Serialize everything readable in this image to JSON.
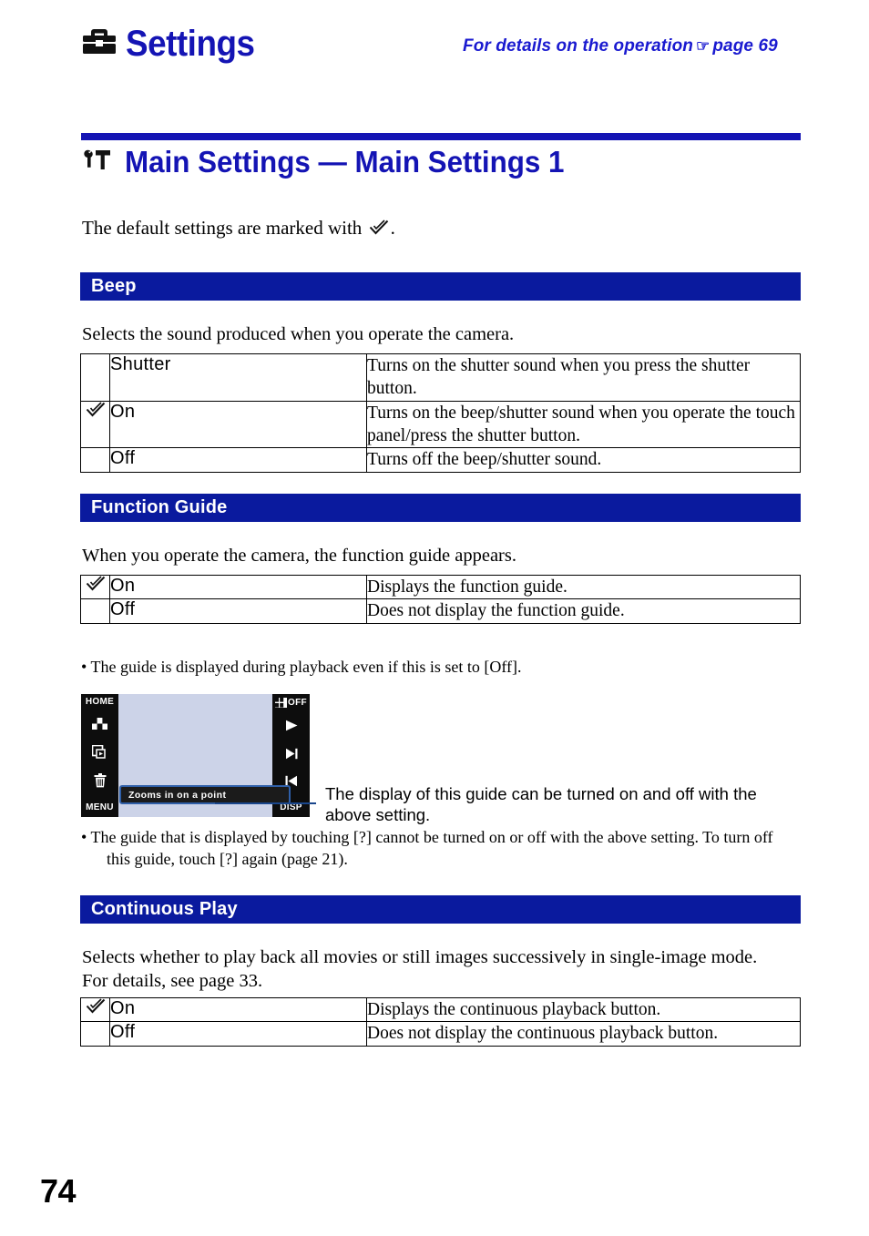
{
  "running_head": {
    "icon": "toolbox-icon",
    "title": "Settings",
    "reference": "For details on the operation",
    "hand_glyph": "☞",
    "page_ref": "page 69"
  },
  "chapter": {
    "icon": "wrench-hammer-icon",
    "title": "Main Settings — Main Settings 1",
    "rule_color": "#1414b4",
    "title_color": "#1414b4"
  },
  "intro": {
    "before_mark": "The default settings are marked with",
    "after_mark": "."
  },
  "sections": [
    {
      "id": "beep",
      "bar_label": "Beep",
      "description": "Selects the sound produced when you operate the camera.",
      "rows": [
        {
          "default": false,
          "label": "Shutter",
          "description": "Turns on the shutter sound when you press the shutter button."
        },
        {
          "default": true,
          "label": "On",
          "description": "Turns on the beep/shutter sound when you operate the touch panel/press the shutter button."
        },
        {
          "default": false,
          "label": "Off",
          "description": "Turns off the beep/shutter sound."
        }
      ]
    },
    {
      "id": "function-guide",
      "bar_label": "Function Guide",
      "description": "When you operate the camera, the function guide appears.",
      "rows": [
        {
          "default": true,
          "label": "On",
          "description": "Displays the function guide."
        },
        {
          "default": false,
          "label": "Off",
          "description": "Does not display the function guide."
        }
      ],
      "note": "• The guide is displayed during playback even if this is set to [Off].",
      "note_after_line1": "• The guide that is displayed by touching [?] cannot be turned on or off with the above setting. To turn off",
      "note_after_line2": "this guide, touch [?] again (page 21)."
    },
    {
      "id": "continuous-play",
      "bar_label": "Continuous Play",
      "description": "Selects whether to play back all movies or still images successively in single-image mode.\nFor details, see page 33.",
      "rows": [
        {
          "default": true,
          "label": "On",
          "description": "Displays the continuous playback button."
        },
        {
          "default": false,
          "label": "Off",
          "description": "Does not display the continuous playback button."
        }
      ]
    }
  ],
  "illustration": {
    "left_buttons": [
      {
        "name": "home-button",
        "text": "HOME"
      },
      {
        "name": "index-view-icon",
        "text": ""
      },
      {
        "name": "slideshow-icon",
        "text": ""
      },
      {
        "name": "delete-trash-icon",
        "text": ""
      },
      {
        "name": "menu-button",
        "text": "MENU"
      }
    ],
    "right_buttons": [
      {
        "name": "grid-off-icon",
        "text": "OFF"
      },
      {
        "name": "play-icon",
        "text": ""
      },
      {
        "name": "next-track-icon",
        "text": ""
      },
      {
        "name": "previous-track-icon",
        "text": ""
      },
      {
        "name": "disp-button",
        "text": "DISP"
      }
    ],
    "tooltip": "Zooms in on a point",
    "screen_bg": "#ccd3e8",
    "bezel_color": "#0d0d0d",
    "tooltip_border": "#2f5fa8"
  },
  "callout": {
    "text": "The display of this guide can be turned on and off with the above setting.",
    "line_color": "#19468c"
  },
  "folio": "74"
}
